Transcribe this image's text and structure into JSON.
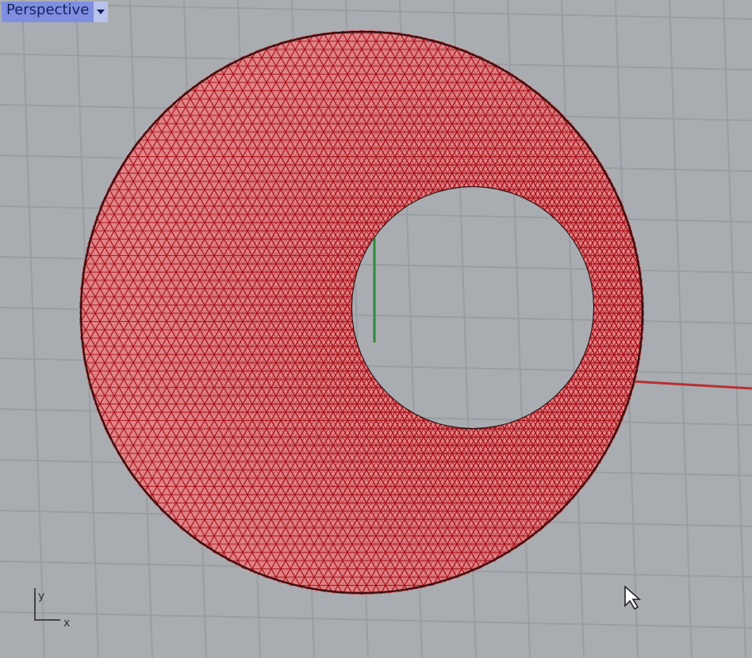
{
  "viewport": {
    "title": "Perspective"
  },
  "axes": {
    "x_label": "x",
    "y_label": "y"
  }
}
